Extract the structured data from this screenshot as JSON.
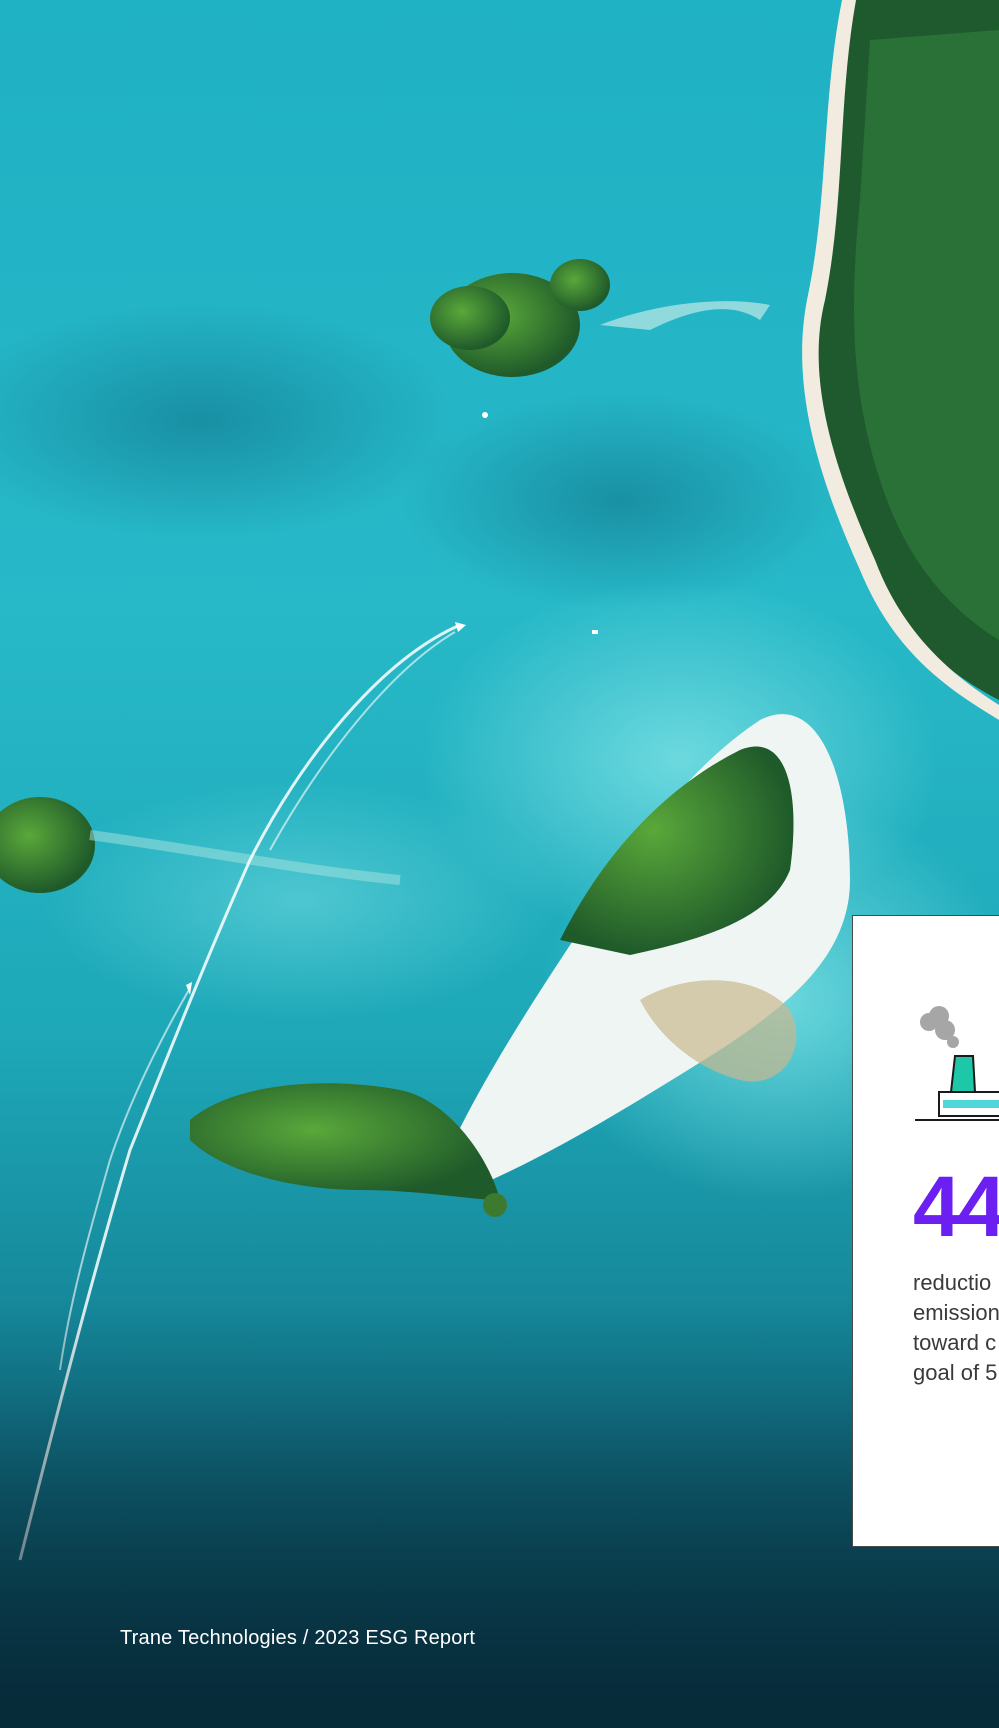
{
  "footer": {
    "text": "Trane Technologies / 2023 ESG Report"
  },
  "stat_card": {
    "value": "44",
    "description_lines": [
      "reductio",
      "emission",
      "toward c",
      "goal of 5"
    ],
    "icon": "factory-emissions-icon"
  },
  "colors": {
    "stat_accent": "#6b1ff0",
    "icon_teal": "#1ec7a8",
    "icon_light": "#4fd6d6",
    "smoke": "#a0a0a0",
    "text_footer": "#ffffff"
  }
}
